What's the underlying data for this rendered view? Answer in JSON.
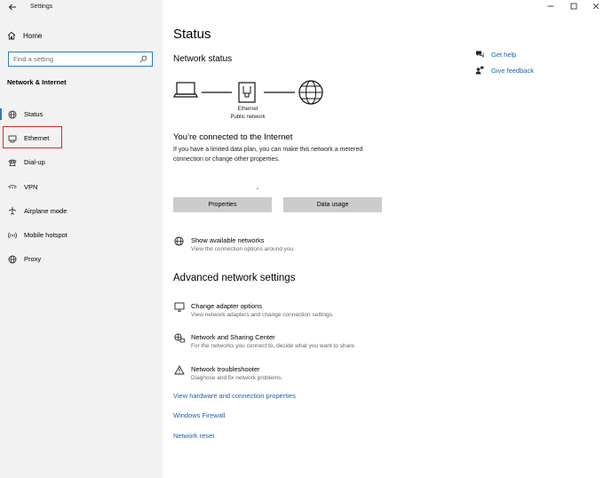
{
  "window": {
    "title": "Settings",
    "controls": [
      "minimize",
      "maximize",
      "close"
    ]
  },
  "sidebar": {
    "home_label": "Home",
    "search_placeholder": "Find a setting",
    "section_title": "Network & Internet",
    "items": [
      {
        "label": "Status",
        "icon": "globe-icon"
      },
      {
        "label": "Ethernet",
        "icon": "ethernet-icon"
      },
      {
        "label": "Dial-up",
        "icon": "phone-icon"
      },
      {
        "label": "VPN",
        "icon": "vpn-icon"
      },
      {
        "label": "Airplane mode",
        "icon": "airplane-icon"
      },
      {
        "label": "Mobile hotspot",
        "icon": "hotspot-icon"
      },
      {
        "label": "Proxy",
        "icon": "globe-icon"
      }
    ]
  },
  "main": {
    "title": "Status",
    "network_status_heading": "Network status",
    "connection_name": "Ethernet",
    "connection_type": "Public network",
    "connected_heading": "You’re connected to the Internet",
    "connected_desc": "If you have a limited data plan, you can make this network a metered connection or change other properties.",
    "buttons": {
      "properties": "Properties",
      "data_usage": "Data usage"
    },
    "show_networks": {
      "title": "Show available networks",
      "desc": "View the connection options around you."
    },
    "advanced_heading": "Advanced network settings",
    "advanced_items": [
      {
        "title": "Change adapter options",
        "desc": "View network adapters and change connection settings."
      },
      {
        "title": "Network and Sharing Center",
        "desc": "For the networks you connect to, decide what you want to share."
      },
      {
        "title": "Network troubleshooter",
        "desc": "Diagnose and fix network problems."
      }
    ],
    "links": [
      "View hardware and connection properties",
      "Windows Firewall",
      "Network reset"
    ]
  },
  "help": {
    "get_help": "Get help",
    "give_feedback": "Give feedback"
  },
  "colors": {
    "accent": "#2b78d0",
    "link": "#1a5fb4",
    "highlight": "#e0262b",
    "sidebar_bg": "#f2f2f2",
    "button_bg": "#cccccc"
  }
}
